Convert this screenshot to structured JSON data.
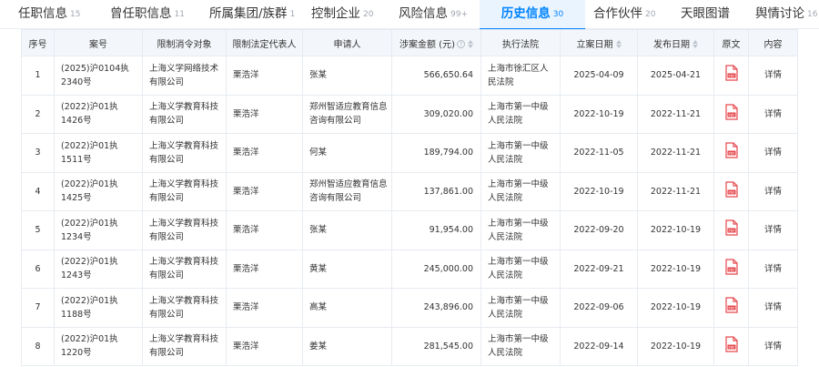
{
  "tabs": [
    {
      "label": "任职信息",
      "count": "15",
      "active": false
    },
    {
      "label": "曾任职信息",
      "count": "11",
      "active": false
    },
    {
      "label": "所属集团/族群",
      "count": "1",
      "active": false
    },
    {
      "label": "控制企业",
      "count": "20",
      "active": false
    },
    {
      "label": "风险信息",
      "count": "99+",
      "active": false
    },
    {
      "label": "历史信息",
      "count": "30",
      "active": true
    },
    {
      "label": "合作伙伴",
      "count": "20",
      "active": false
    },
    {
      "label": "天眼图谱",
      "count": "",
      "active": false
    },
    {
      "label": "舆情讨论",
      "count": "16",
      "active": false
    }
  ],
  "table": {
    "headers": {
      "index": "序号",
      "case_no": "案号",
      "restricted_target": "限制消令对象",
      "legal_rep": "限制法定代表人",
      "applicant": "申请人",
      "amount": "涉案金额 (元)",
      "court": "执行法院",
      "filing_date": "立案日期",
      "publish_date": "发布日期",
      "original": "原文",
      "content": "内容"
    },
    "rows": [
      {
        "index": "1",
        "case_no": "(2025)沪0104执2340号",
        "target": "上海义学网络技术有限公司",
        "rep": "栗浩洋",
        "applicant": "张某",
        "applicant_link": false,
        "amount": "566,650.64",
        "court": "上海市徐汇区人民法院",
        "filing_date": "2025-04-09",
        "publish_date": "2025-04-21",
        "detail": "详情"
      },
      {
        "index": "2",
        "case_no": "(2022)沪01执1426号",
        "target": "上海义学教育科技有限公司",
        "rep": "栗浩洋",
        "applicant": "郑州智适应教育信息咨询有限公司",
        "applicant_link": true,
        "amount": "309,020.00",
        "court": "上海市第一中级人民法院",
        "filing_date": "2022-10-19",
        "publish_date": "2022-11-21",
        "detail": "详情"
      },
      {
        "index": "3",
        "case_no": "(2022)沪01执1511号",
        "target": "上海义学教育科技有限公司",
        "rep": "栗浩洋",
        "applicant": "何某",
        "applicant_link": false,
        "amount": "189,794.00",
        "court": "上海市第一中级人民法院",
        "filing_date": "2022-11-05",
        "publish_date": "2022-11-21",
        "detail": "详情"
      },
      {
        "index": "4",
        "case_no": "(2022)沪01执1425号",
        "target": "上海义学教育科技有限公司",
        "rep": "栗浩洋",
        "applicant": "郑州智适应教育信息咨询有限公司",
        "applicant_link": true,
        "amount": "137,861.00",
        "court": "上海市第一中级人民法院",
        "filing_date": "2022-10-19",
        "publish_date": "2022-11-21",
        "detail": "详情"
      },
      {
        "index": "5",
        "case_no": "(2022)沪01执1234号",
        "target": "上海义学教育科技有限公司",
        "rep": "栗浩洋",
        "applicant": "张某",
        "applicant_link": false,
        "amount": "91,954.00",
        "court": "上海市第一中级人民法院",
        "filing_date": "2022-09-20",
        "publish_date": "2022-10-19",
        "detail": "详情"
      },
      {
        "index": "6",
        "case_no": "(2022)沪01执1243号",
        "target": "上海义学教育科技有限公司",
        "rep": "栗浩洋",
        "applicant": "黄某",
        "applicant_link": false,
        "amount": "245,000.00",
        "court": "上海市第一中级人民法院",
        "filing_date": "2022-09-21",
        "publish_date": "2022-10-19",
        "detail": "详情"
      },
      {
        "index": "7",
        "case_no": "(2022)沪01执1188号",
        "target": "上海义学教育科技有限公司",
        "rep": "栗浩洋",
        "applicant": "高某",
        "applicant_link": false,
        "amount": "243,896.00",
        "court": "上海市第一中级人民法院",
        "filing_date": "2022-09-06",
        "publish_date": "2022-10-19",
        "detail": "详情"
      },
      {
        "index": "8",
        "case_no": "(2022)沪01执1220号",
        "target": "上海义学教育科技有限公司",
        "rep": "栗浩洋",
        "applicant": "姜某",
        "applicant_link": false,
        "amount": "281,545.00",
        "court": "上海市第一中级人民法院",
        "filing_date": "2022-09-14",
        "publish_date": "2022-10-19",
        "detail": "详情"
      }
    ]
  },
  "icons": {
    "pdf": "pdf-file-icon",
    "help": "question-circle-icon",
    "sort": "sort-arrows-icon"
  },
  "colors": {
    "link": "#0084ff",
    "pdf_red": "#e5484d",
    "header_bg": "#f3f6fa",
    "active_tab_bg": "#eaf4ff"
  }
}
